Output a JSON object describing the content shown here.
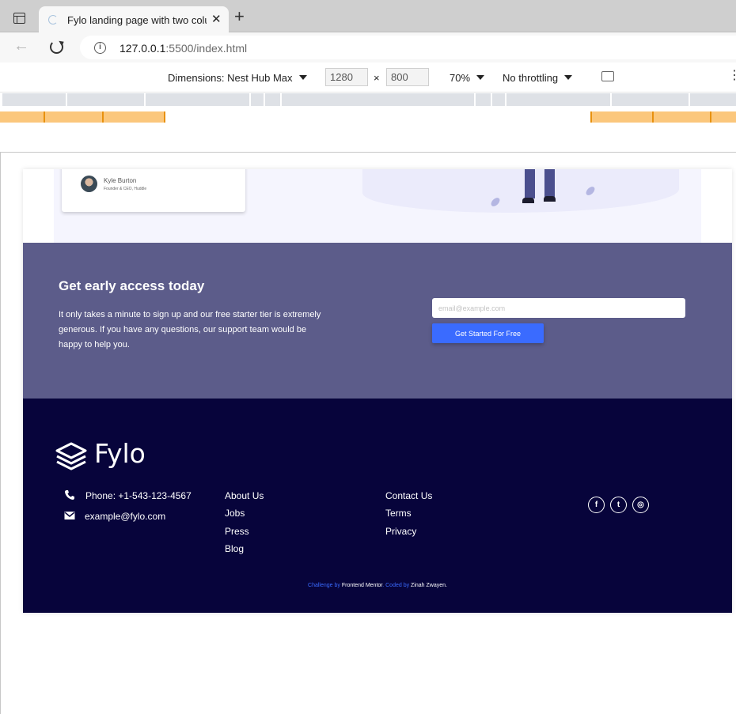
{
  "browser": {
    "tab_title": "Fylo landing page with two colum",
    "url_host": "127.0.0.1",
    "url_path": ":5500/index.html",
    "new_tab": "+"
  },
  "devtools": {
    "device": "Dimensions: Nest Hub Max",
    "width": "1280",
    "height": "800",
    "times": "×",
    "zoom": "70%",
    "throttling": "No throttling"
  },
  "testimonial": {
    "name": "Kyle Burton",
    "role": "Founder & CEO, Huddle"
  },
  "access": {
    "title": "Get early access today",
    "text": "It only takes a minute to sign up and our free starter tier is extremely generous. If you have any questions, our support team would be happy to help you.",
    "email_placeholder": "email@example.com",
    "cta_label": "Get Started For Free"
  },
  "footer": {
    "brand": "Fylo",
    "phone": "Phone: +1-543-123-4567",
    "email": "example@fylo.com",
    "links_col1": [
      "About Us",
      "Jobs",
      "Press",
      "Blog"
    ],
    "links_col2": [
      "Contact Us",
      "Terms",
      "Privacy"
    ],
    "socials": [
      {
        "icon": "facebook-icon",
        "glyph": "f"
      },
      {
        "icon": "twitter-icon",
        "glyph": "t"
      },
      {
        "icon": "instagram-icon",
        "glyph": "◎"
      }
    ],
    "credits": {
      "challenge_prefix": "Challenge by",
      "challenge_by": "Frontend Mentor",
      "coded_prefix": ". Coded by",
      "coded_by": "Zinah Zwayen",
      "suffix": "."
    }
  },
  "colors": {
    "access_bg": "#5c5c8a",
    "footer_bg": "#07043b",
    "cta_bg": "#3a6bff",
    "testimonial_bg": "#f5f5fe"
  }
}
